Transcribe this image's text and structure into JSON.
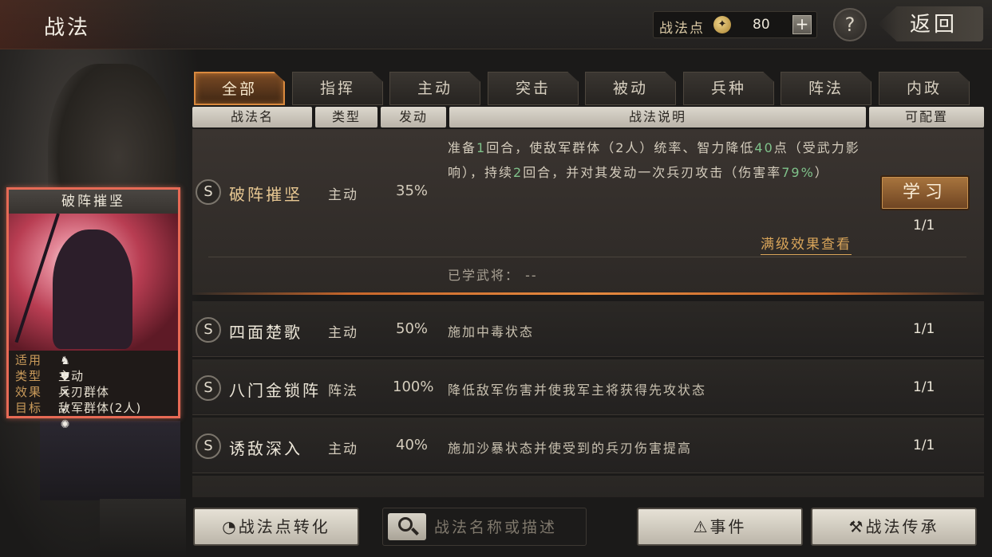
{
  "header": {
    "title": "战法",
    "points_label": "战法点",
    "points_value": "80",
    "plus": "+",
    "help": "?",
    "back_label": "返回"
  },
  "tabs": [
    {
      "label": "全部",
      "active": true
    },
    {
      "label": "指挥",
      "active": false
    },
    {
      "label": "主动",
      "active": false
    },
    {
      "label": "突击",
      "active": false
    },
    {
      "label": "被动",
      "active": false
    },
    {
      "label": "兵种",
      "active": false
    },
    {
      "label": "阵法",
      "active": false
    },
    {
      "label": "内政",
      "active": false
    }
  ],
  "columns": {
    "name": "战法名",
    "type": "类型",
    "trigger": "发动",
    "description": "战法说明",
    "configurable": "可配置"
  },
  "expanded": {
    "grade": "S",
    "name": "破阵摧坚",
    "type": "主动",
    "rate": "35%",
    "desc_1": "准备",
    "desc_2": "1",
    "desc_3": "回合，使敌军群体（2人）统率、智力降低",
    "desc_4": "40",
    "desc_5": "点（受武力影响），持续",
    "desc_6": "2",
    "desc_7": "回合，并对其发动一次兵刃攻击（伤害率",
    "desc_8": "79%",
    "desc_9": "）",
    "learn_button": "学习",
    "count": "1/1",
    "max_level_link": "满级效果查看",
    "learned_label": "已学武将：  --"
  },
  "rows": [
    {
      "grade": "S",
      "name": "四面楚歌",
      "type": "主动",
      "rate": "50%",
      "desc": "施加中毒状态",
      "count": "1/1"
    },
    {
      "grade": "S",
      "name": "八门金锁阵",
      "type": "阵法",
      "rate": "100%",
      "desc": "降低敌军伤害并使我军主将获得先攻状态",
      "count": "1/1"
    },
    {
      "grade": "S",
      "name": "诱敌深入",
      "type": "主动",
      "rate": "40%",
      "desc": "施加沙暴状态并使受到的兵刃伤害提高",
      "count": "1/1"
    }
  ],
  "card": {
    "title": "破阵摧坚",
    "applies_key": "适用",
    "unit_icons": [
      "cavalry-icon",
      "shield-icon",
      "bow-icon",
      "spear-icon",
      "siege-icon"
    ],
    "type_key": "类型",
    "type_val": "主动",
    "effect_key": "效果",
    "effect_val": "兵刃群体",
    "target_key": "目标",
    "target_val": "敌军群体(2人)"
  },
  "bottom": {
    "convert_button": "战法点转化",
    "search_placeholder": "战法名称或描述",
    "events_button": "事件",
    "inherit_button": "战法传承"
  }
}
